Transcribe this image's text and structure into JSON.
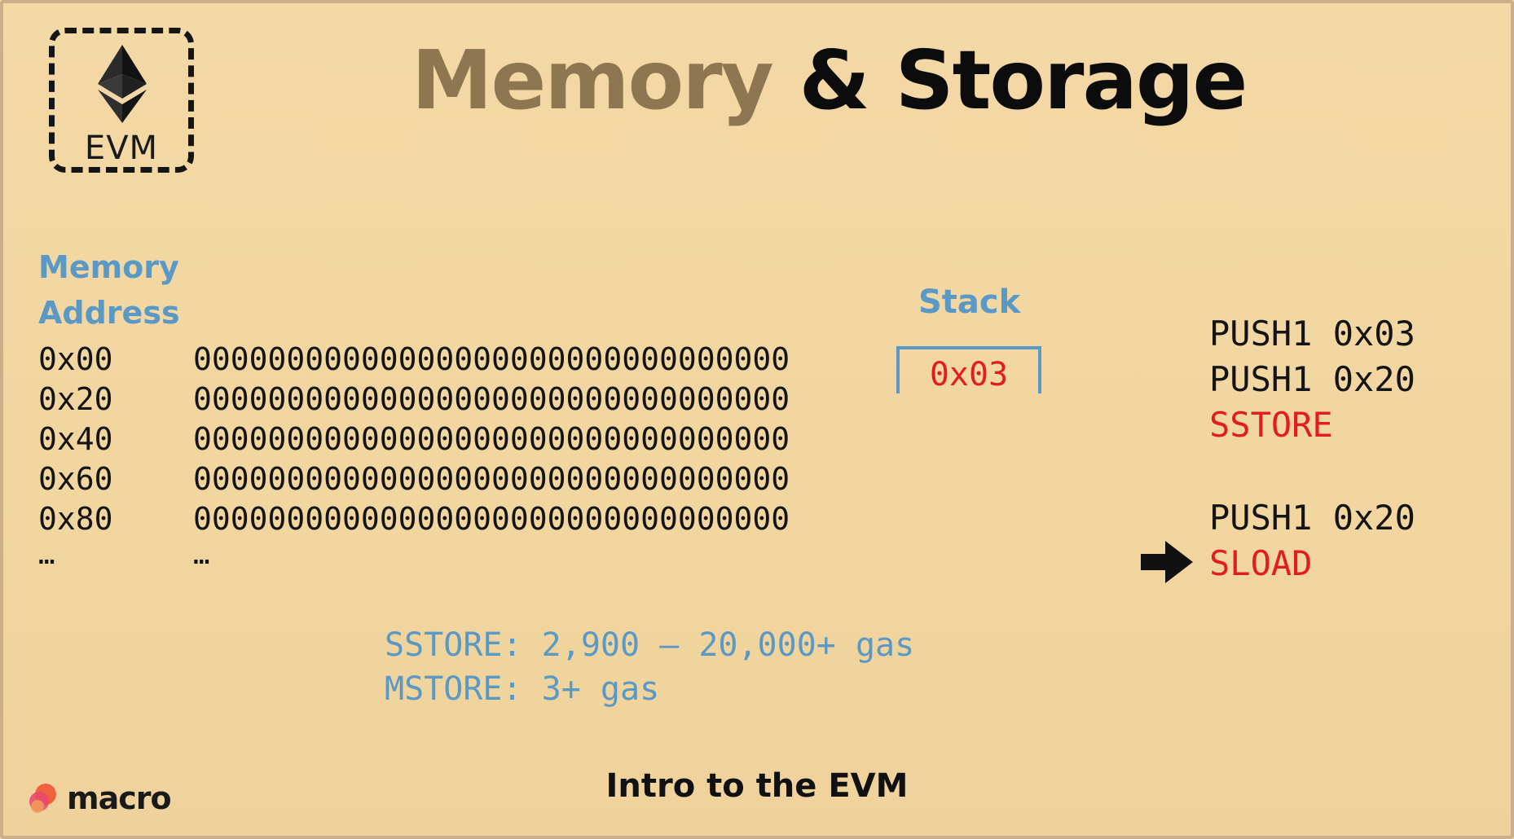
{
  "logo": {
    "label": "EVM",
    "icon": "ethereum-icon"
  },
  "title": {
    "part1": "Memory",
    "part2": "& Storage",
    "colors": {
      "part1": "#8d7650",
      "part2": "#0c0c0c"
    }
  },
  "memory": {
    "heading_line1": "Memory",
    "heading_line2": "Address",
    "rows": [
      {
        "address": "0x00",
        "value": "00000000000000000000000000000000"
      },
      {
        "address": "0x20",
        "value": "00000000000000000000000000000000"
      },
      {
        "address": "0x40",
        "value": "00000000000000000000000000000000"
      },
      {
        "address": "0x60",
        "value": "00000000000000000000000000000000"
      },
      {
        "address": "0x80",
        "value": "00000000000000000000000000000000"
      }
    ],
    "ellipsis": "…"
  },
  "stack": {
    "heading": "Stack",
    "items": [
      "0x03"
    ]
  },
  "opcodes": {
    "group1": [
      "PUSH1 0x03",
      "PUSH1 0x20",
      "SSTORE"
    ],
    "group2": [
      "PUSH1 0x20",
      "SLOAD"
    ],
    "current_icon": "arrow-right-icon"
  },
  "gas": {
    "sstore": "SSTORE: 2,900 – 20,000+ gas",
    "mstore": "MSTORE: 3+ gas"
  },
  "footer": {
    "brand": "macro",
    "title": "Intro to the EVM"
  },
  "colors": {
    "accent_blue": "#5a98c6",
    "highlight_red": "#e11d1d",
    "background": "#f3d9a6"
  }
}
